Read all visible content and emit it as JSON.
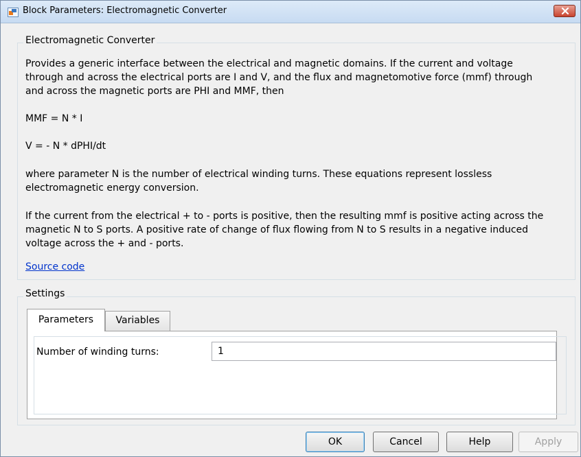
{
  "window": {
    "title": "Block Parameters: Electromagnetic Converter"
  },
  "description": {
    "group_title": "Electromagnetic Converter",
    "lines": [
      "Provides a generic interface between the electrical and magnetic domains. If the current and voltage",
      "through and across the electrical ports are I and V, and the flux and magnetomotive force (mmf) through",
      "and across the magnetic ports are PHI and MMF, then",
      "MMF = N * I",
      "V = - N * dPHI/dt",
      "where parameter N is the number of electrical winding turns. These equations represent lossless",
      "electromagnetic energy conversion.",
      "If the current from the electrical + to - ports is positive, then the resulting mmf is positive acting across the",
      "magnetic N to S ports. A positive rate of change of flux flowing from N to S results in a negative induced",
      "voltage across the + and - ports."
    ],
    "source_link": "Source code"
  },
  "settings": {
    "group_title": "Settings",
    "tabs": [
      {
        "label": "Parameters",
        "active": true
      },
      {
        "label": "Variables",
        "active": false
      }
    ],
    "params": {
      "winding_label": "Number of winding turns:",
      "winding_value": "1"
    }
  },
  "buttons": {
    "ok": "OK",
    "cancel": "Cancel",
    "help": "Help",
    "apply": "Apply"
  }
}
